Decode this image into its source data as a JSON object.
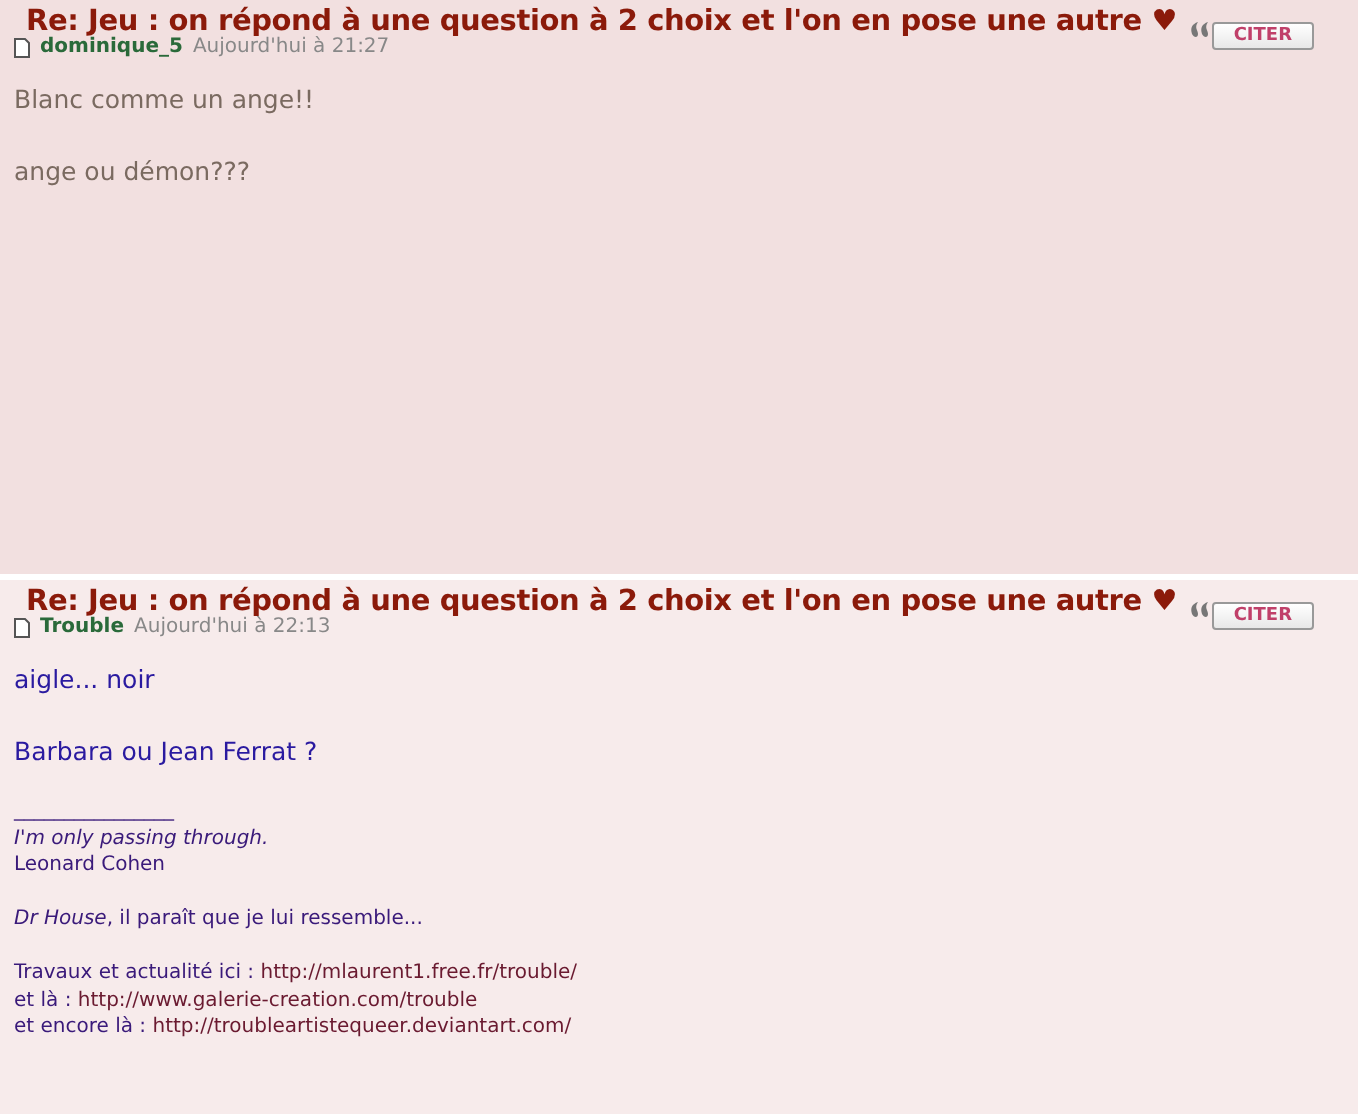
{
  "posts": [
    {
      "title": "Re: Jeu : on répond à une question à 2 choix et l'on en pose une autre ♥",
      "author": "dominique_5",
      "date": "Aujourd'hui à 21:27",
      "quote_button": "CITER",
      "body": [
        "Blanc comme un ange!!",
        "ange ou démon???"
      ]
    },
    {
      "title": "Re: Jeu : on répond à une question à 2 choix et l'on en pose une autre ♥",
      "author": "Trouble",
      "date": "Aujourd'hui à 22:13",
      "quote_button": "CITER",
      "body": [
        "aigle... noir",
        "Barbara ou Jean Ferrat ?"
      ],
      "signature": [
        {
          "kind": "rule",
          "text": "________________"
        },
        {
          "kind": "italic",
          "text": "I'm only passing through."
        },
        {
          "kind": "text",
          "text": "Leonard Cohen"
        },
        {
          "kind": "blank"
        },
        {
          "kind": "text",
          "text": "*Dr House*, il paraît que je lui ressemble..."
        },
        {
          "kind": "blank"
        },
        {
          "kind": "link",
          "text": "Travaux et actualité ici :",
          "link": "http://mlaurent1.free.fr/trouble/"
        },
        {
          "kind": "link",
          "text": "et là :",
          "link": "http://www.galerie-creation.com/trouble"
        },
        {
          "kind": "link",
          "text": "et encore là :",
          "link": "http://troubleartistequeer.deviantart.com/"
        }
      ]
    }
  ]
}
